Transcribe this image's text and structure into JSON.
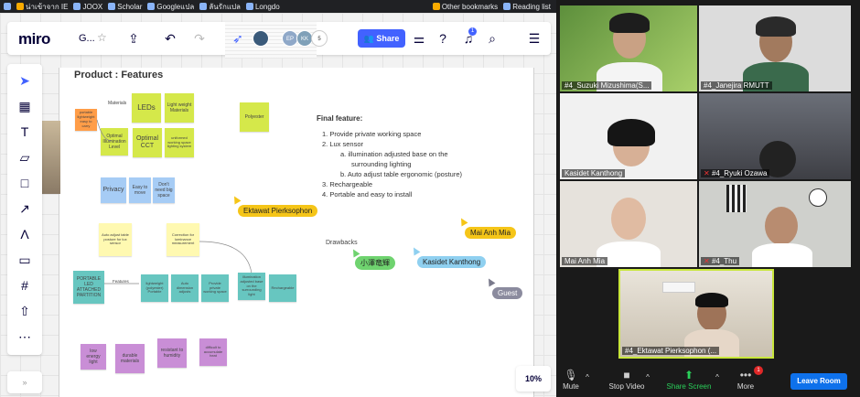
{
  "bookmarks": {
    "items": [
      "น่าเข้าจาก IE",
      "JOOX",
      "Scholar",
      "Googleแปล",
      "ลันรักแปล",
      "Longdo"
    ],
    "other": "Other bookmarks",
    "reading": "Reading list"
  },
  "miro": {
    "logo": "miro",
    "board_name": "G...",
    "share_label": "Share",
    "avatars": [
      "EP",
      "KK"
    ],
    "avatar_count": "5",
    "notif_count": "1",
    "zoom_level": "10%",
    "collapse": "»",
    "frame_title": "Product : Features",
    "materials_label": "Materials",
    "stickies": {
      "orange_small": "portable lightweight easy to carry",
      "leds": "LEDs",
      "light_weight": "Light weight Materials",
      "polyester": "Polyester",
      "optimal_illum": "Optimal Illumination Level",
      "optimal_cct": "Optimal CCT",
      "uniformed": "uniformed working space lighting system",
      "privacy": "Privacy",
      "easy_move": "Easy to move",
      "dont_need": "Don't need big space",
      "auto_adjust": "Auto adjust table posture for lux sensor",
      "correction": "Correction for luminance measurement",
      "portable_led": "PORTABLE LED ATTACHED PARTITION",
      "lightweight_portable": "lightweight (polyester) Portable",
      "auto_dim": "Auto dimension adjusts",
      "provide_private": "Provide private working space",
      "illum_adjusted": "illumination adjusted base on the surrounding light",
      "rechargeable": "Rechargeable",
      "low_energy": "low energy light",
      "durable": "durable materials",
      "resistant": "resistant to humidity",
      "difficult": "difficult to accumulate heat"
    },
    "features_label": "Features",
    "final_feature": {
      "title": "Final feature:",
      "i1": "1.  Provide private working space",
      "i2": "2.  Lux sensor",
      "i2a": "a.  illumination adjusted base on the",
      "i2a2": "surrounding lighting",
      "i2b": "b.  Auto adjust table ergonomic (posture)",
      "i3": "3.  Rechargeable",
      "i4": "4.  Portable and easy to install"
    },
    "drawbacks": "Drawbacks",
    "cursors": {
      "ektawat": "Ektawat Pierksophon",
      "mai": "Mai Anh Mia",
      "kasidet": "Kasidet Kanthong",
      "jp": "小澤竜輝",
      "guest": "Guest"
    },
    "colors": {
      "accent": "#4262ff",
      "yellow_sticky": "#d5e84a",
      "blue_sticky": "#a6ccf5",
      "teal_sticky": "#67c6c0",
      "purple_sticky": "#c98ed6",
      "pale_yellow": "#fff9b1",
      "orange_sticky": "#ff9d48"
    }
  },
  "zoom": {
    "tiles": [
      "#4_Suzuki Mizushima(S...",
      "#4_Janejira RMUTT",
      "Kasidet Kanthong",
      "#4_Ryuki Ozawa",
      "Mai Anh Mia",
      "#4_Thu",
      "#4_Ektawat Pierksophon (..."
    ],
    "controls": {
      "mute": "Mute",
      "stop_video": "Stop Video",
      "share_screen": "Share Screen",
      "more": "More",
      "more_badge": "1",
      "leave": "Leave Room"
    }
  }
}
